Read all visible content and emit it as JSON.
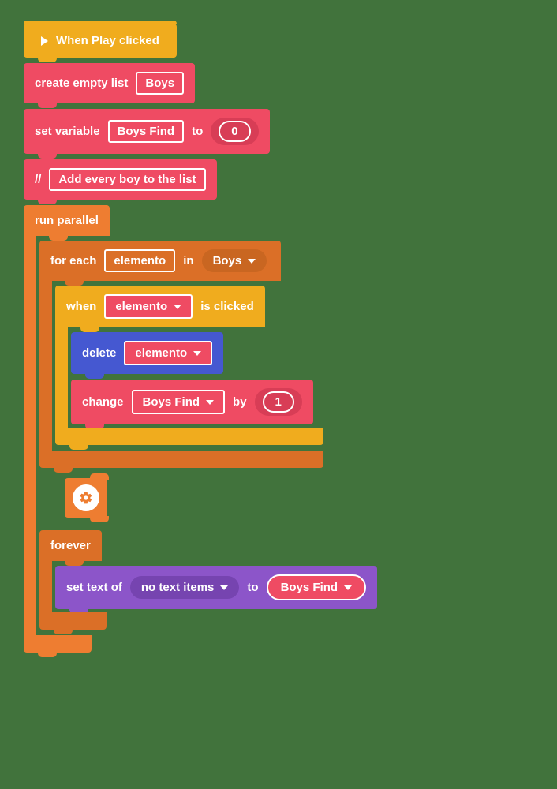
{
  "hat": {
    "label": "When Play clicked"
  },
  "createList": {
    "prefix": "create empty list",
    "varName": "Boys"
  },
  "setVar": {
    "prefix": "set variable",
    "varName": "Boys Find",
    "mid": "to",
    "value": "0"
  },
  "comment": {
    "prefix": "//",
    "text": "Add every boy to the list"
  },
  "parallel": {
    "label": "run parallel"
  },
  "foreach": {
    "prefix": "for each",
    "varName": "elemento",
    "mid": "in",
    "listName": "Boys"
  },
  "when": {
    "prefix": "when",
    "dropdown": "elemento",
    "suffix": "is clicked"
  },
  "delete": {
    "prefix": "delete",
    "dropdown": "elemento"
  },
  "change": {
    "prefix": "change",
    "dropdown": "Boys Find",
    "mid": "by",
    "value": "1"
  },
  "forever": {
    "label": "forever"
  },
  "setText": {
    "prefix": "set text of",
    "target": "no text items",
    "mid": "to",
    "value": "Boys Find"
  }
}
